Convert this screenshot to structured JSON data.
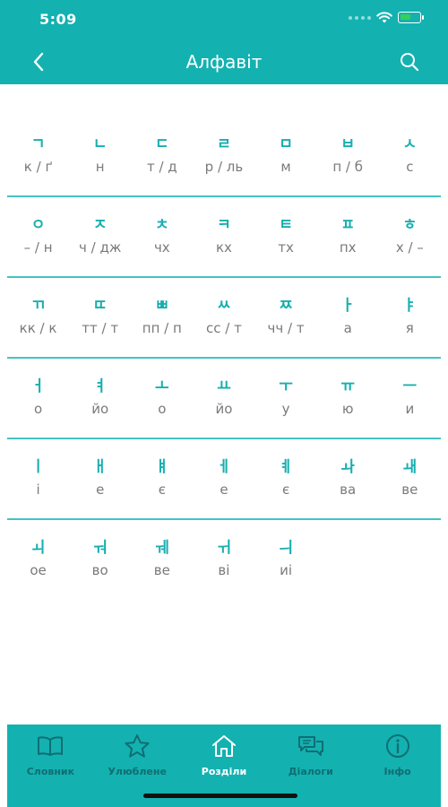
{
  "status_bar": {
    "time": "5:09",
    "battery_level": 0.6,
    "battery_color": "#34d058"
  },
  "header": {
    "title": "Алфавіт",
    "back_icon": "chevron-left-icon",
    "search_icon": "search-icon"
  },
  "colors": {
    "accent": "#14b1b1",
    "hangul": "#19aeb0",
    "divider": "#45c2c4",
    "translit": "#7a7a7a",
    "tab_inactive": "#0f6e72",
    "tab_active": "#ffffff"
  },
  "alphabet": {
    "rows": [
      [
        {
          "hangul": "ㄱ",
          "translit": "к / ґ"
        },
        {
          "hangul": "ㄴ",
          "translit": "н"
        },
        {
          "hangul": "ㄷ",
          "translit": "т / д"
        },
        {
          "hangul": "ㄹ",
          "translit": "р / ль"
        },
        {
          "hangul": "ㅁ",
          "translit": "м"
        },
        {
          "hangul": "ㅂ",
          "translit": "п / б"
        },
        {
          "hangul": "ㅅ",
          "translit": "с"
        }
      ],
      [
        {
          "hangul": "ㅇ",
          "translit": "– / н"
        },
        {
          "hangul": "ㅈ",
          "translit": "ч / дж"
        },
        {
          "hangul": "ㅊ",
          "translit": "чх"
        },
        {
          "hangul": "ㅋ",
          "translit": "кх"
        },
        {
          "hangul": "ㅌ",
          "translit": "тх"
        },
        {
          "hangul": "ㅍ",
          "translit": "пх"
        },
        {
          "hangul": "ㅎ",
          "translit": "х / –"
        }
      ],
      [
        {
          "hangul": "ㄲ",
          "translit": "кк / к"
        },
        {
          "hangul": "ㄸ",
          "translit": "тт / т"
        },
        {
          "hangul": "ㅃ",
          "translit": "пп / п"
        },
        {
          "hangul": "ㅆ",
          "translit": "сс / т"
        },
        {
          "hangul": "ㅉ",
          "translit": "чч / т"
        },
        {
          "hangul": "ㅏ",
          "translit": "а"
        },
        {
          "hangul": "ㅑ",
          "translit": "я"
        }
      ],
      [
        {
          "hangul": "ㅓ",
          "translit": "о"
        },
        {
          "hangul": "ㅕ",
          "translit": "йо"
        },
        {
          "hangul": "ㅗ",
          "translit": "о"
        },
        {
          "hangul": "ㅛ",
          "translit": "йо"
        },
        {
          "hangul": "ㅜ",
          "translit": "у"
        },
        {
          "hangul": "ㅠ",
          "translit": "ю"
        },
        {
          "hangul": "ㅡ",
          "translit": "и"
        }
      ],
      [
        {
          "hangul": "ㅣ",
          "translit": "і"
        },
        {
          "hangul": "ㅐ",
          "translit": "е"
        },
        {
          "hangul": "ㅒ",
          "translit": "є"
        },
        {
          "hangul": "ㅔ",
          "translit": "е"
        },
        {
          "hangul": "ㅖ",
          "translit": "є"
        },
        {
          "hangul": "ㅘ",
          "translit": "ва"
        },
        {
          "hangul": "ㅙ",
          "translit": "ве"
        }
      ],
      [
        {
          "hangul": "ㅚ",
          "translit": "ое"
        },
        {
          "hangul": "ㅝ",
          "translit": "во"
        },
        {
          "hangul": "ㅞ",
          "translit": "ве"
        },
        {
          "hangul": "ㅟ",
          "translit": "ві"
        },
        {
          "hangul": "ㅢ",
          "translit": "иі"
        }
      ]
    ]
  },
  "tab_bar": {
    "tabs": [
      {
        "label": "Словник",
        "icon": "book-icon",
        "active": false
      },
      {
        "label": "Улюблене",
        "icon": "star-icon",
        "active": false
      },
      {
        "label": "Розділи",
        "icon": "home-icon",
        "active": true
      },
      {
        "label": "Діалоги",
        "icon": "chat-bubbles-icon",
        "active": false
      },
      {
        "label": "Інфо",
        "icon": "info-icon",
        "active": false
      }
    ]
  }
}
